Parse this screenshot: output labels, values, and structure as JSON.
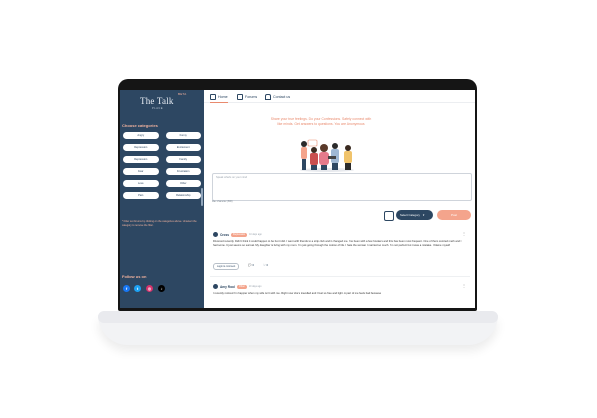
{
  "app": {
    "logo": "The Talk",
    "badge": "BETA",
    "subtitle": "PLACE"
  },
  "nav": [
    {
      "label": "Home",
      "icon": "home-icon"
    },
    {
      "label": "Forums",
      "icon": "forums-icon"
    },
    {
      "label": "Contact us",
      "icon": "headset-icon"
    }
  ],
  "sidebar": {
    "categories_title": "Choose categories",
    "categories": [
      "Angry",
      "Funny",
      "Depression",
      "Excitement",
      "Depression",
      "Family",
      "Fear",
      "Frustration",
      "Love",
      "Other",
      "Pain",
      "Relationship"
    ],
    "note": "* Filter out forums by clicking on the categories above. Unselect the category to remove the filter.",
    "follow_title": "Follow us on",
    "socials": [
      {
        "name": "facebook",
        "glyph": "f",
        "color": "#1877f2"
      },
      {
        "name": "twitter",
        "glyph": "t",
        "color": "#1da1f2"
      },
      {
        "name": "instagram",
        "glyph": "◎",
        "color": "#d6336c"
      },
      {
        "name": "tiktok",
        "glyph": "♪",
        "color": "#000000"
      }
    ]
  },
  "hero": {
    "text": "Share your true feelings. Do your Confessions. Safely connect with like minds. Get answers to questions. You are Anonymous"
  },
  "composer": {
    "placeholder": "Speak what's on your mind",
    "char_count": "Max character (800)",
    "select_label": "Select Category",
    "post_label": "Post"
  },
  "posts": [
    {
      "author": "Cross",
      "tag": "Depression",
      "time": "10 days ago",
      "text": "Divorced recently. Didn't think it could happen to be but it did. I went with friends to a strip club and it changed me. I've been with a few hookers and this has been most frequent. One of them snorted meth and I had some. It just seems so surreal. My daughter is living with my mum. I'm just going through the motion of life. I hate the woman I married so much. I'm not perfect but it was a mistake. I blame myself",
      "login_label": "Login to comment",
      "comments": "0",
      "likes": "0"
    },
    {
      "author": "Amy Rool",
      "tag": "Other",
      "time": "10 days ago",
      "text": "I recently noticed I'm happier when my wife isn't with me. Right now she's travelled and I feel so free and light. A part of me feels bad because"
    }
  ]
}
